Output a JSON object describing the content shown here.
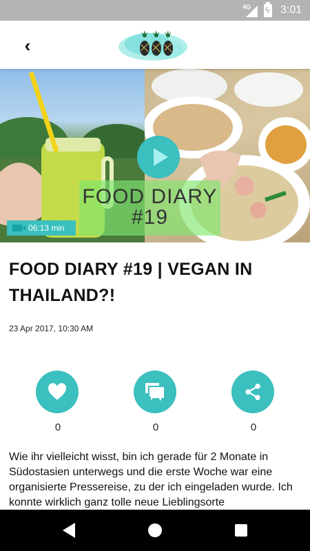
{
  "status_bar": {
    "network": "4G",
    "time": "3:01"
  },
  "app_bar": {
    "back_icon": "chevron-left-icon",
    "logo_icon": "pineapples-logo-icon"
  },
  "hero": {
    "overlay_title_line1": "FOOD DIARY",
    "overlay_title_line2": "#19",
    "duration": "06:13 min",
    "play_icon": "play-icon"
  },
  "article": {
    "title": "FOOD DIARY #19 | VEGAN IN THAILAND?!",
    "date": "23 Apr 2017, 10:30 AM",
    "body": "Wie ihr vielleicht wisst, bin ich gerade für 2 Monate in Südostasien unterwegs und die erste Woche war eine organisierte Pressereise, zu der ich eingeladen wurde. Ich konnte wirklich ganz tolle neue Lieblingsorte"
  },
  "actions": {
    "like_count": "0",
    "comment_count": "0",
    "share_count": "0"
  },
  "colors": {
    "accent": "#3bbfbf",
    "status_bar": "#b3b3b3",
    "nav_bar": "#000000"
  }
}
